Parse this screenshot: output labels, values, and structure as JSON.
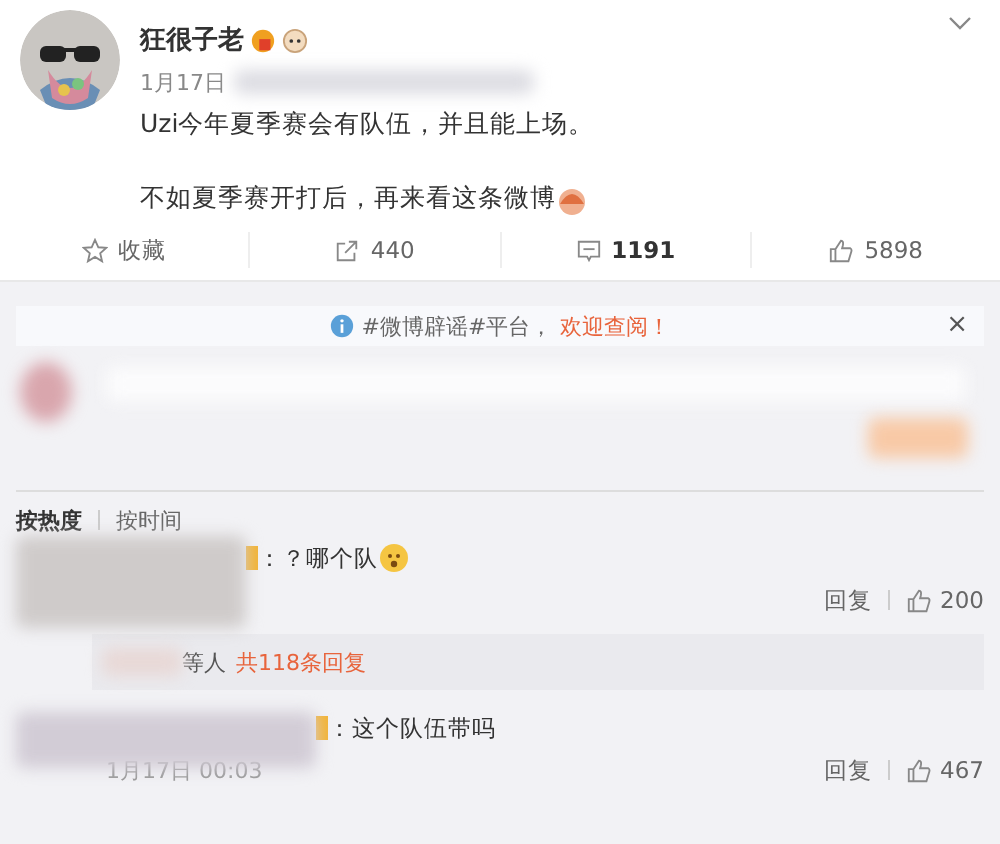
{
  "post": {
    "author": "狂很子老",
    "date": "1月17日",
    "lines": [
      "Uzi今年夏季赛会有队伍，并且能上场。",
      "不如夏季赛开打后，再来看这条微博"
    ]
  },
  "actions": [
    {
      "kind": "star",
      "label": "收藏"
    },
    {
      "kind": "share",
      "label": "440"
    },
    {
      "kind": "comment",
      "label": "1191",
      "selected": true
    },
    {
      "kind": "like",
      "label": "5898"
    }
  ],
  "notice": {
    "text": "#微博辟谣#平台，",
    "link": "欢迎查阅！",
    "close": "×"
  },
  "sort_tabs": [
    {
      "label": "按热度",
      "selected": true
    },
    {
      "label": "按时间",
      "selected": false
    }
  ],
  "comments": [
    {
      "text": "：？哪个队",
      "reply": "回复",
      "likes": "200",
      "replies_prefix": "等人",
      "replies_link": "共118条回复"
    },
    {
      "text": "：这个队伍带吗",
      "time": "1月17日 00:03",
      "reply": "回复",
      "likes": "467"
    }
  ]
}
